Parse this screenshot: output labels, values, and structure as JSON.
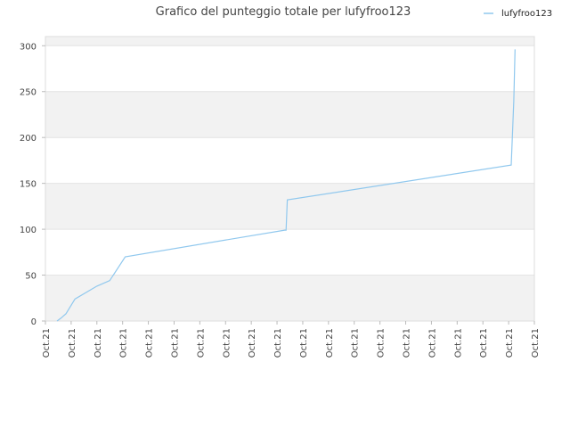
{
  "chart_data": {
    "type": "line",
    "title": "Grafico del punteggio totale per lufyfroo123",
    "xlabel": "",
    "ylabel": "",
    "legend": {
      "placement": "top-right",
      "entries": [
        "lufyfroo123"
      ]
    },
    "grid": true,
    "band_colors": [
      "#f2f2f2",
      "#ffffff"
    ],
    "series_color": "#90c8ee",
    "ylim": [
      0,
      310
    ],
    "yticks": [
      0,
      50,
      100,
      150,
      200,
      250,
      300
    ],
    "xlim": [
      0,
      19
    ],
    "xticks": [
      {
        "x": 0,
        "label": "Oct.21"
      },
      {
        "x": 1,
        "label": "Oct.21"
      },
      {
        "x": 2,
        "label": "Oct.21"
      },
      {
        "x": 3,
        "label": "Oct.21"
      },
      {
        "x": 4,
        "label": "Oct.21"
      },
      {
        "x": 5,
        "label": "Oct.21"
      },
      {
        "x": 6,
        "label": "Oct.21"
      },
      {
        "x": 7,
        "label": "Oct.21"
      },
      {
        "x": 8,
        "label": "Oct.21"
      },
      {
        "x": 9,
        "label": "Oct.21"
      },
      {
        "x": 10,
        "label": "Oct.21"
      },
      {
        "x": 11,
        "label": "Oct.21"
      },
      {
        "x": 12,
        "label": "Oct.21"
      },
      {
        "x": 13,
        "label": "Oct.21"
      },
      {
        "x": 14,
        "label": "Oct.21"
      },
      {
        "x": 15,
        "label": "Oct.21"
      },
      {
        "x": 16,
        "label": "Oct.21"
      },
      {
        "x": 17,
        "label": "Oct.21"
      },
      {
        "x": 18,
        "label": "Oct.21"
      },
      {
        "x": 19,
        "label": "Oct.21"
      }
    ],
    "series": [
      {
        "name": "lufyfroo123",
        "points": [
          [
            0.45,
            0
          ],
          [
            0.5,
            1
          ],
          [
            0.6,
            3
          ],
          [
            0.8,
            8
          ],
          [
            1.15,
            24
          ],
          [
            2.0,
            38
          ],
          [
            2.5,
            44
          ],
          [
            3.1,
            70
          ],
          [
            9.3,
            99
          ],
          [
            9.35,
            99
          ],
          [
            9.4,
            132
          ],
          [
            18.1,
            170
          ],
          [
            18.2,
            240
          ],
          [
            18.25,
            296
          ]
        ]
      }
    ]
  }
}
